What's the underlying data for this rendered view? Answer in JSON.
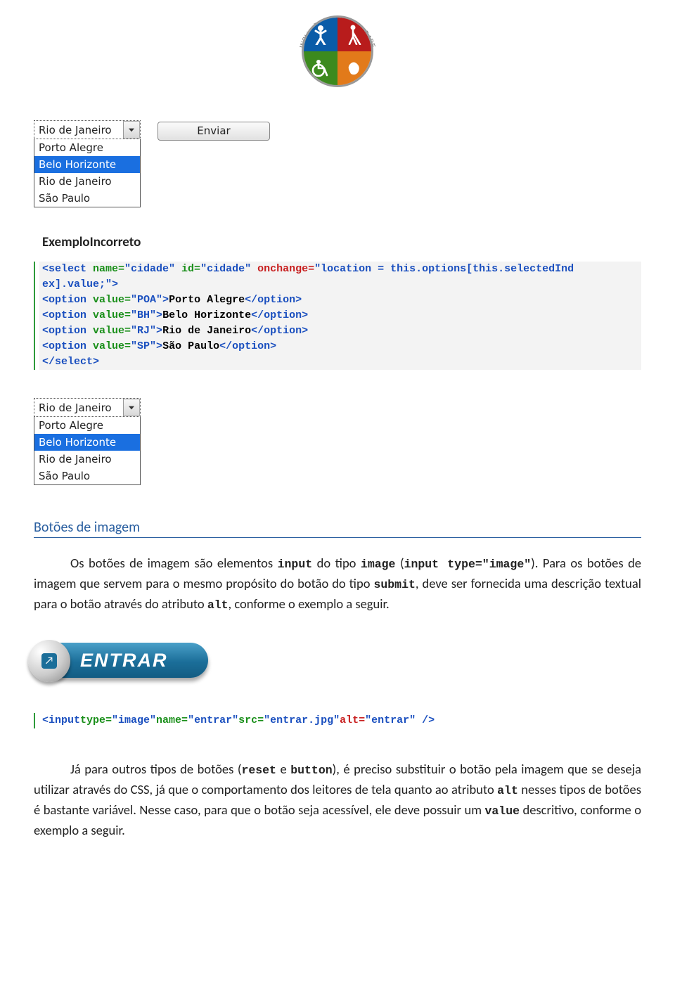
{
  "logo": {
    "ring_top": "INCLUSÃO E ACESSIBILIDADE",
    "ring_left": "NÚCLEO DE"
  },
  "combo1": {
    "selected": "Rio de Janeiro",
    "options": [
      "Porto Alegre",
      "Belo Horizonte",
      "Rio de Janeiro",
      "São Paulo"
    ],
    "highlighted_index": 1
  },
  "send_button": "Enviar",
  "heading_incorrect": "ExemploIncorreto",
  "code1": {
    "l1a": "<select",
    "l1b": " name=",
    "l1c": "\"cidade\"",
    "l1d": " id=",
    "l1e": "\"cidade\"",
    "l1f": " onchange=",
    "l1g": "\"location = this.options[this.selectedInd",
    "l2a": "ex].value;\"",
    "l2b": ">",
    "l3a": "<option",
    "l3b": " value=",
    "l3c": "\"POA\"",
    "l3d": ">",
    "l3e": "Porto Alegre",
    "l3f": "</option>",
    "l4a": "<option",
    "l4b": " value=",
    "l4c": "\"BH\"",
    "l4d": ">",
    "l4e": "Belo Horizonte",
    "l4f": "</option>",
    "l5a": "<option",
    "l5b": " value=",
    "l5c": "\"RJ\"",
    "l5d": ">",
    "l5e": "Rio de Janeiro",
    "l5f": "</option>",
    "l6a": "<option",
    "l6b": " value=",
    "l6c": "\"SP\"",
    "l6d": ">",
    "l6e": "São Paulo",
    "l6f": "</option>",
    "l7a": "</select>"
  },
  "combo2": {
    "selected": "Rio de Janeiro",
    "options": [
      "Porto Alegre",
      "Belo Horizonte",
      "Rio de Janeiro",
      "São Paulo"
    ],
    "highlighted_index": 1
  },
  "section_title": "Botões de imagem",
  "para1_a": "Os botões de imagem são elementos ",
  "para1_b": "input",
  "para1_c": " do tipo ",
  "para1_d": "image",
  "para1_e": " (",
  "para1_f": "input type=\"image\"",
  "para1_g": "). Para os botões de imagem que servem para o mesmo propósito do botão do tipo ",
  "para1_h": "submit",
  "para1_i": ", deve ser fornecida uma descrição textual para o botão através do atributo ",
  "para1_j": "alt",
  "para1_k": ", conforme o exemplo a seguir.",
  "enter_label": "ENTRAR",
  "code2": {
    "a": "<input",
    "b": "type=",
    "c": "\"image\"",
    "d": "name=",
    "e": "\"entrar\"",
    "f": "src=",
    "g": "\"entrar.jpg\"",
    "h": "alt=",
    "i": "\"entrar\"",
    "j": " />"
  },
  "para2_a": "Já para outros tipos de botões (",
  "para2_b": "reset",
  "para2_c": " e ",
  "para2_d": "button",
  "para2_e": "), é preciso substituir o botão pela imagem que se deseja utilizar através do CSS, já que o comportamento dos leitores de tela quanto ao atributo ",
  "para2_f": "alt",
  "para2_g": " nesses tipos de botões é bastante variável. Nesse caso, para que o botão seja acessível, ele deve possuir um ",
  "para2_h": "value",
  "para2_i": " descritivo, conforme o exemplo a seguir."
}
